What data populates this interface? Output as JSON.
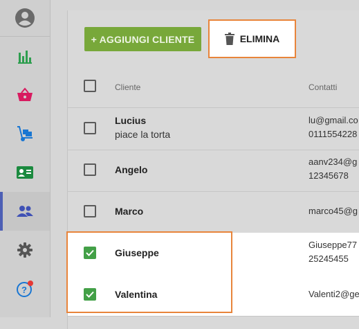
{
  "sidebar": {
    "items": [
      {
        "icon": "bar-chart-icon",
        "color": "#2e9e4f"
      },
      {
        "icon": "basket-icon",
        "color": "#d81b60"
      },
      {
        "icon": "hand-truck-icon",
        "color": "#1976d2"
      },
      {
        "icon": "contact-card-icon",
        "color": "#1b8a3f"
      },
      {
        "icon": "people-icon",
        "color": "#3f51b5",
        "active": true
      },
      {
        "icon": "gear-icon",
        "color": "#555555"
      },
      {
        "icon": "help-icon",
        "color": "#1976d2",
        "badge_color": "#e53935"
      }
    ]
  },
  "toolbar": {
    "add_label": "+ AGGIUNGI CLIENTE",
    "delete_label": "ELIMINA",
    "add_color": "#78a83a",
    "highlight_color": "#e8843a"
  },
  "table": {
    "headers": {
      "client": "Cliente",
      "contacts": "Contatti"
    },
    "rows": [
      {
        "name": "Lucius",
        "note": "piace la torta",
        "contact1": "lu@gmail.co",
        "contact2": "0111554228",
        "checked": false
      },
      {
        "name": "Angelo",
        "note": "",
        "contact1": "aanv234@g",
        "contact2": "12345678",
        "checked": false
      },
      {
        "name": "Marco",
        "note": "",
        "contact1": "marco45@g",
        "contact2": "",
        "checked": false
      },
      {
        "name": "Giuseppe",
        "note": "",
        "contact1": "Giuseppe77",
        "contact2": "25245455",
        "checked": true
      },
      {
        "name": "Valentina",
        "note": "",
        "contact1": "Valenti2@ge",
        "contact2": "",
        "checked": true
      }
    ]
  }
}
